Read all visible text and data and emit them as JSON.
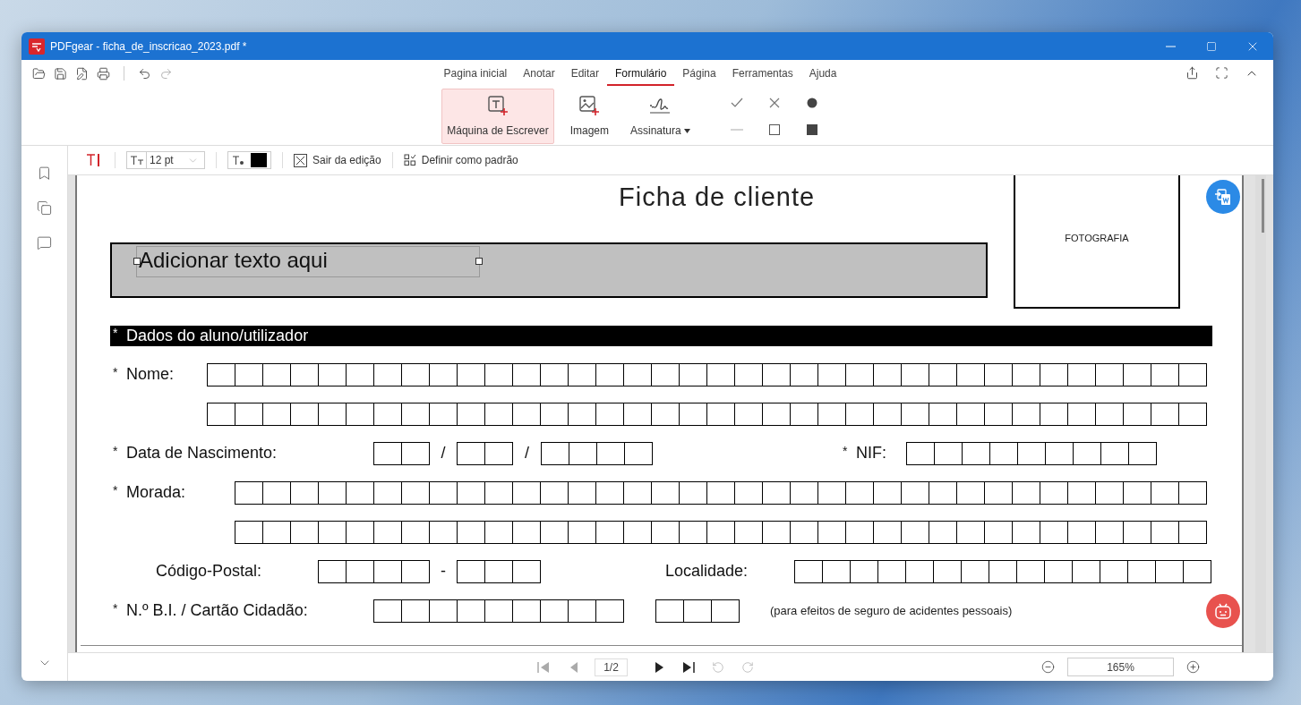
{
  "window": {
    "title": "PDFgear - ficha_de_inscricao_2023.pdf *"
  },
  "tabs": [
    {
      "label": "Pagina inicial",
      "selected": false
    },
    {
      "label": "Anotar",
      "selected": false
    },
    {
      "label": "Editar",
      "selected": false
    },
    {
      "label": "Formulário",
      "selected": true
    },
    {
      "label": "Página",
      "selected": false
    },
    {
      "label": "Ferramentas",
      "selected": false
    },
    {
      "label": "Ajuda",
      "selected": false
    }
  ],
  "ribbon_tools": [
    {
      "kind": "typewriter",
      "label": "Máquina de Escrever",
      "selected": true
    },
    {
      "kind": "image",
      "label": "Imagem",
      "selected": false
    },
    {
      "kind": "signature",
      "label": "Assinatura",
      "selected": false,
      "dropdown": true
    }
  ],
  "shape_tools": [
    {
      "kind": "check"
    },
    {
      "kind": "cross"
    },
    {
      "kind": "dot"
    },
    {
      "kind": "line"
    },
    {
      "kind": "square"
    },
    {
      "kind": "filled-square"
    }
  ],
  "format_bar": {
    "font_size": "12 pt",
    "buttons": [
      "Sair da edição",
      "Definir como padrão"
    ]
  },
  "document": {
    "title": "Ficha de cliente",
    "photo_label": "FOTOGRAFIA",
    "text_box": {
      "value": "Adicionar texto aqui"
    },
    "section": {
      "marker": "*",
      "label": "Dados do aluno/utilizador"
    },
    "rows": [
      {
        "items": [
          {
            "kind": "label",
            "marker": "*",
            "text": "Nome:"
          },
          {
            "kind": "boxes"
          }
        ]
      },
      {
        "items": [
          {
            "kind": "boxes"
          }
        ]
      },
      {
        "items": [
          {
            "kind": "label",
            "marker": "*",
            "text": "Data de Nascimento:"
          },
          {
            "kind": "boxes"
          },
          {
            "kind": "separator",
            "text": "/"
          },
          {
            "kind": "boxes"
          },
          {
            "kind": "separator",
            "text": "/"
          },
          {
            "kind": "boxes"
          },
          {
            "kind": "label",
            "marker": "*",
            "text": "NIF:"
          },
          {
            "kind": "boxes"
          }
        ]
      },
      {
        "items": [
          {
            "kind": "label",
            "marker": "*",
            "text": "Morada:"
          },
          {
            "kind": "boxes"
          }
        ]
      },
      {
        "items": [
          {
            "kind": "boxes"
          }
        ]
      },
      {
        "items": [
          {
            "kind": "label",
            "text": "Código-Postal:"
          },
          {
            "kind": "boxes"
          },
          {
            "kind": "separator",
            "text": "-"
          },
          {
            "kind": "boxes"
          },
          {
            "kind": "label",
            "text": "Localidade:"
          },
          {
            "kind": "boxes"
          }
        ]
      },
      {
        "items": [
          {
            "kind": "label",
            "marker": "*",
            "text": "N.º B.I. / Cartão Cidadão:"
          },
          {
            "kind": "boxes"
          },
          {
            "kind": "separator"
          },
          {
            "kind": "boxes"
          },
          {
            "kind": "note",
            "text": "(para efeitos de seguro de acidentes pessoais)"
          }
        ]
      }
    ]
  },
  "pager": {
    "page": "1/2",
    "zoom": "165%"
  }
}
